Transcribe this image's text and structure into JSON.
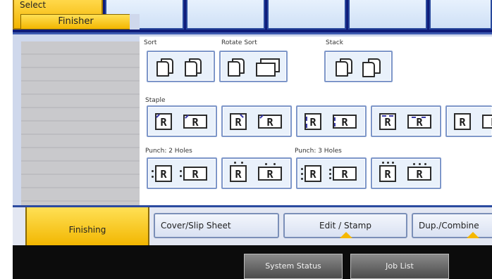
{
  "top_tabs": [
    {
      "label": "Select",
      "active": true
    },
    {
      "label": "",
      "active": false
    },
    {
      "label": "",
      "active": false
    },
    {
      "label": "",
      "active": false
    },
    {
      "label": "",
      "active": false
    },
    {
      "label": "",
      "active": false
    }
  ],
  "left_panel": {
    "finisher_tab": "Finisher"
  },
  "groups": {
    "sort": "Sort",
    "rotate_sort": "Rotate Sort",
    "stack": "Stack",
    "staple": "Staple",
    "punch_2": "Punch: 2 Holes",
    "punch_3": "Punch: 3 Holes"
  },
  "glyph": "R",
  "function_tabs": [
    {
      "label": "Finishing",
      "active": true
    },
    {
      "label": "Cover/Slip Sheet",
      "active": false
    },
    {
      "label": "Edit / Stamp",
      "active": false
    },
    {
      "label": "Dup./Combine",
      "active": false
    }
  ],
  "status_bar": {
    "system_status": "System Status",
    "job_list": "Job List"
  },
  "colors": {
    "accent_yellow": "#f2b600",
    "frame_blue": "#2b4aa0",
    "panel_bg": "#cfd8ec",
    "status_bg": "#0c0c0c"
  }
}
